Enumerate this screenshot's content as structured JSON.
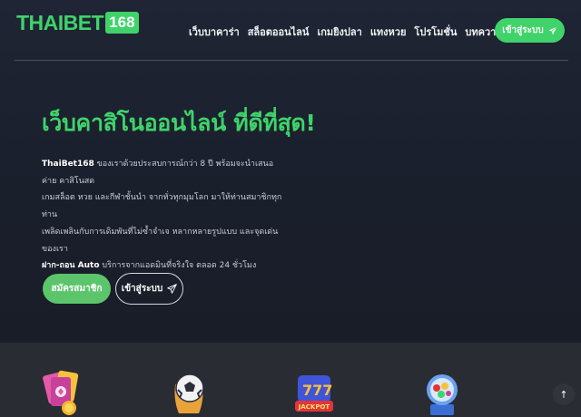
{
  "header": {
    "logo_text": "THAIBET",
    "logo_number": "168",
    "nav_items": [
      "เว็บบาคาร่า",
      "สล็อตออนไลน์",
      "เกมยิงปลา",
      "แทงหวย",
      "โปรโมชั่น",
      "บทความ"
    ],
    "login_button": "เข้าสู่ระบบ"
  },
  "hero": {
    "headline": "เว็บคาสิโนออนไลน์ ที่ดีที่สุด!",
    "desc_lines": [
      "ThaiBet168 ของเราด้วยประสบการณ์กว่า 8 ปี พร้อมจะนำเสนอค่าย คาสิโนสด",
      "เกมสล็อต หวย และกีฬาชั้นนำ จากทั่วทุกมุมโลก มาให้ท่านสมาชิกทุกท่าน",
      "เพลิดเพลินกับการเดิมพันที่ไม่ซ้ำจำเจ หลากหลายรูปแบบ และจุดเด่นของเรา",
      "ฝาก-ถอน Auto บริการจากแอดมินที่จริงใจ ตลอด 24 ชั่วโมง"
    ],
    "desc_brand": "ThaiBet168",
    "desc_auto": "ฝาก-ถอน Auto",
    "register_button": "สมัครสมาชิก",
    "login_button": "เข้าสู่ระบบ"
  },
  "games": {
    "icons": [
      "casino-cards-icon",
      "football-icon",
      "slot-jackpot-icon",
      "lottery-machine-icon"
    ],
    "jackpot_label": "JACKPOT"
  },
  "back_to_top": "↑",
  "colors": {
    "accent": "#3fd36a",
    "background": "#1a1e29",
    "games_strip": "#292c33"
  }
}
